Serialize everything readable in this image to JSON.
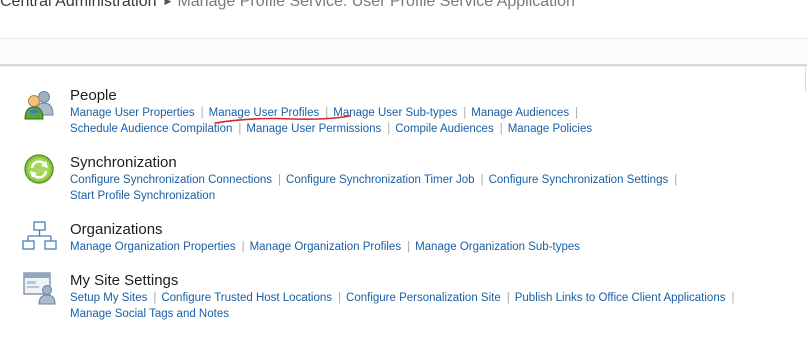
{
  "breadcrumb": {
    "root": "Central Administration",
    "current": "Manage Profile Service: User Profile Service Application"
  },
  "sections": {
    "people": {
      "title": "People",
      "row1": [
        "Manage User Properties",
        "Manage User Profiles",
        "Manage User Sub-types",
        "Manage Audiences"
      ],
      "row2": [
        "Schedule Audience Compilation",
        "Manage User Permissions",
        "Compile Audiences",
        "Manage Policies"
      ]
    },
    "synchronization": {
      "title": "Synchronization",
      "row1": [
        "Configure Synchronization Connections",
        "Configure Synchronization Timer Job",
        "Configure Synchronization Settings"
      ],
      "row2": [
        "Start Profile Synchronization"
      ]
    },
    "organizations": {
      "title": "Organizations",
      "row1": [
        "Manage Organization Properties",
        "Manage Organization Profiles",
        "Manage Organization Sub-types"
      ]
    },
    "my_site": {
      "title": "My Site Settings",
      "row1": [
        "Setup My Sites",
        "Configure Trusted Host Locations",
        "Configure Personalization Site",
        "Publish Links to Office Client Applications"
      ],
      "row2": [
        "Manage Social Tags and Notes"
      ]
    }
  },
  "icons": {
    "people": "people-icon",
    "synchronization": "sync-icon",
    "organizations": "org-chart-icon",
    "my_site": "my-site-settings-icon"
  },
  "colors": {
    "link": "#1a5fa6",
    "annotation": "#d8262e",
    "title": "#1d1d1d"
  },
  "separator": "|"
}
